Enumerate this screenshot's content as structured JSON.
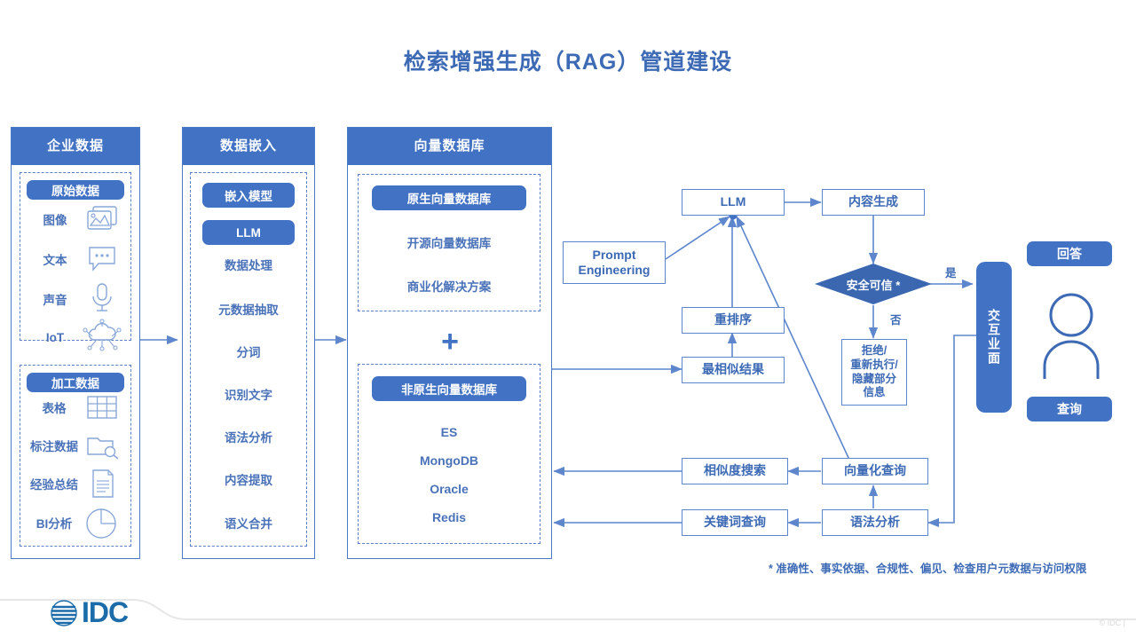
{
  "title": "检索增强生成（RAG）管道建设",
  "columns": [
    {
      "header": "企业数据",
      "groups": [
        {
          "title": "原始数据",
          "items": [
            {
              "label": "图像",
              "icon": "images-icon"
            },
            {
              "label": "文本",
              "icon": "chat-bubble-icon"
            },
            {
              "label": "声音",
              "icon": "microphone-icon"
            },
            {
              "label": "IoT",
              "icon": "iot-cloud-icon"
            }
          ]
        },
        {
          "title": "加工数据",
          "items": [
            {
              "label": "表格",
              "icon": "table-icon"
            },
            {
              "label": "标注数据",
              "icon": "folder-search-icon"
            },
            {
              "label": "经验总结",
              "icon": "document-icon"
            },
            {
              "label": "BI分析",
              "icon": "pie-chart-icon"
            }
          ]
        }
      ]
    },
    {
      "header": "数据嵌入",
      "pills": [
        "嵌入模型",
        "LLM"
      ],
      "items": [
        "数据处理",
        "元数据抽取",
        "分词",
        "识别文字",
        "语法分析",
        "内容提取",
        "语义合并"
      ]
    },
    {
      "header": "向量数据库",
      "groups": [
        {
          "title": "原生向量数据库",
          "items": [
            "开源向量数据库",
            "商业化解决方案"
          ]
        },
        {
          "title": "非原生向量数据库",
          "items": [
            "ES",
            "MongoDB",
            "Oracle",
            "Redis"
          ]
        }
      ],
      "connector": "+"
    }
  ],
  "flow": {
    "llm": "LLM",
    "content_generation": "内容生成",
    "prompt_engineering": "Prompt Engineering",
    "rerank": "重排序",
    "top_results": "最相似结果",
    "safety_decision": "安全可信 *",
    "yes_label": "是",
    "no_label": "否",
    "reject_box": "拒绝/\n重新执行/\n隐藏部分\n信息",
    "reject_lines": [
      "拒绝/",
      "重新执行/",
      "隐藏部分",
      "信息"
    ],
    "similarity_search": "相似度搜索",
    "vector_query": "向量化查询",
    "keyword_query": "关键词查询",
    "syntax_analysis": "语法分析",
    "interaction_surface": "交互业面",
    "answer": "回答",
    "query": "查询",
    "user_icon": "user-avatar-icon"
  },
  "footnote": "* 准确性、事实依据、合规性、偏见、检查用户元数据与访问权限",
  "footer": {
    "logo_text": "IDC",
    "logo_icon": "idc-globe-icon",
    "copyright": "© IDC |"
  },
  "colors": {
    "brand_blue": "#4272c4",
    "text_blue": "#3d6ab5",
    "line_blue": "#5d86cc",
    "dash_blue": "#5b7fc4"
  }
}
